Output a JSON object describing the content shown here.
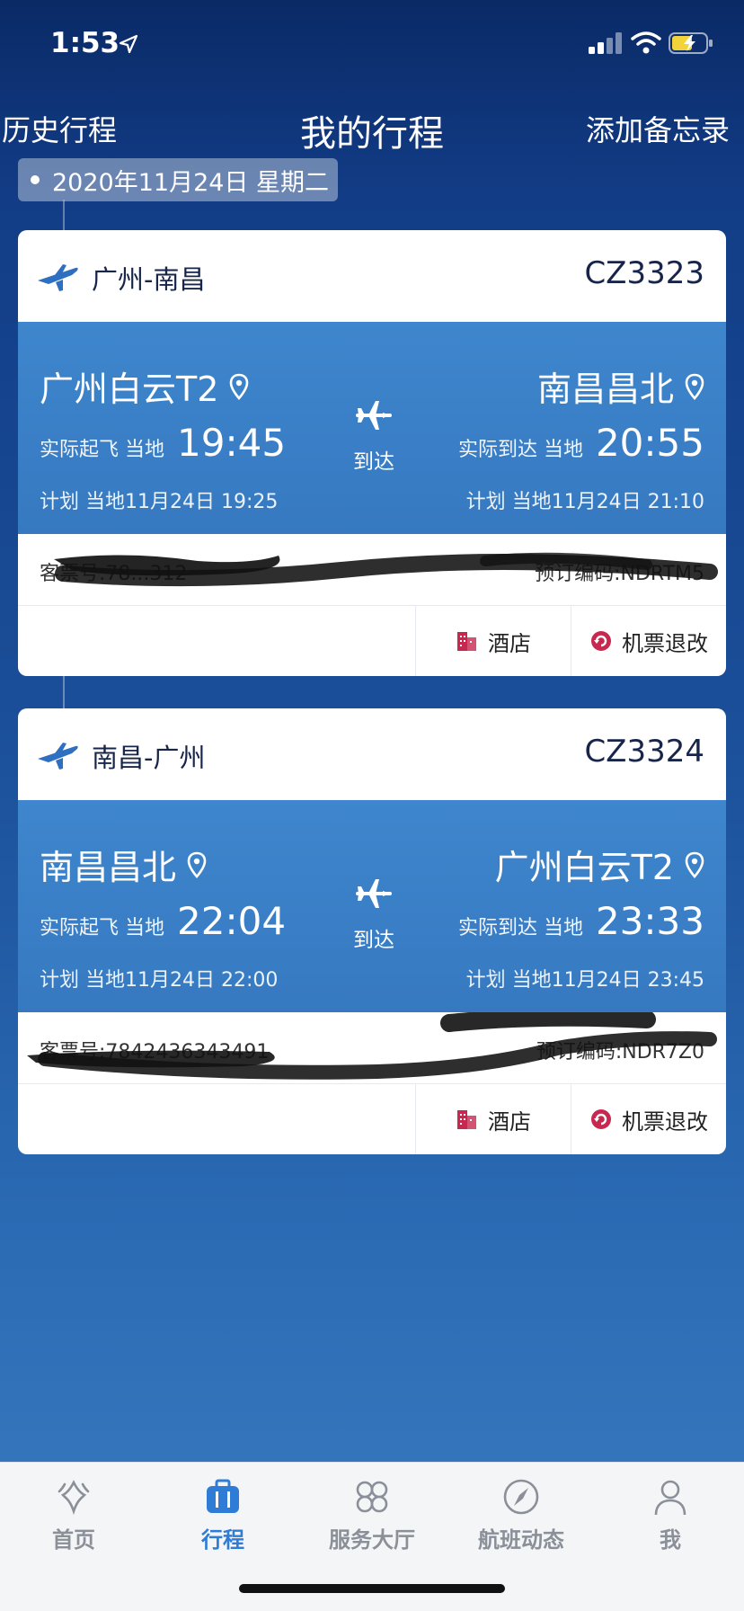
{
  "status": {
    "time": "1:53"
  },
  "header": {
    "left": "历史行程",
    "title": "我的行程",
    "right": "添加备忘录"
  },
  "date_label": "2020年11月24日 星期二",
  "flights": [
    {
      "route": "广州-南昌",
      "flight_no": "CZ3323",
      "dep_airport": "广州白云T2",
      "arr_airport": "南昌昌北",
      "dep_label": "实际起飞 当地",
      "dep_time": "19:45",
      "arr_label": "实际到达 当地",
      "arr_time": "20:55",
      "status": "到达",
      "dep_sched": "计划 当地11月24日 19:25",
      "arr_sched": "计划 当地11月24日 21:10",
      "ticket_no": "客票号:78...312",
      "booking_code": "预订编码:NDRTM5",
      "hotel_label": "酒店",
      "change_label": "机票退改"
    },
    {
      "route": "南昌-广州",
      "flight_no": "CZ3324",
      "dep_airport": "南昌昌北",
      "arr_airport": "广州白云T2",
      "dep_label": "实际起飞 当地",
      "dep_time": "22:04",
      "arr_label": "实际到达 当地",
      "arr_time": "23:33",
      "status": "到达",
      "dep_sched": "计划 当地11月24日 22:00",
      "arr_sched": "计划 当地11月24日 23:45",
      "ticket_no": "客票号:7842436343491",
      "booking_code": "预订编码:NDR7Z0",
      "hotel_label": "酒店",
      "change_label": "机票退改"
    }
  ],
  "tabs": [
    {
      "label": "首页",
      "icon": "home-icon"
    },
    {
      "label": "行程",
      "icon": "trip-icon"
    },
    {
      "label": "服务大厅",
      "icon": "services-icon"
    },
    {
      "label": "航班动态",
      "icon": "compass-icon"
    },
    {
      "label": "我",
      "icon": "profile-icon"
    }
  ],
  "colors": {
    "accent": "#2f7cd6",
    "card_band": "#3a80c7",
    "hotel_icon": "#c8284f"
  }
}
